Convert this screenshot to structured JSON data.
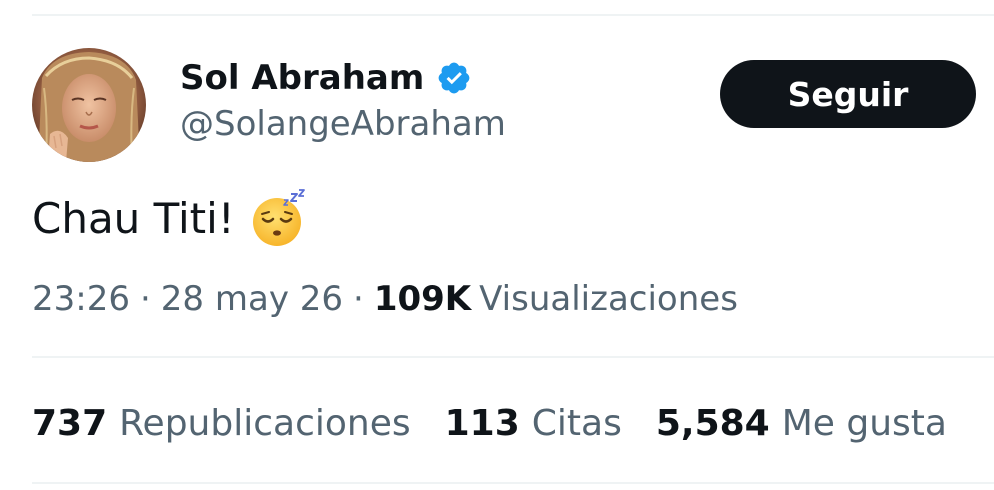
{
  "tweet": {
    "author": {
      "display_name": "Sol Abraham",
      "handle": "@SolangeAbraham",
      "verified_icon": "verified-badge-icon",
      "avatar_icon": "avatar-photo"
    },
    "follow_button": {
      "label": "Seguir"
    },
    "text": "Chau Titi!",
    "emoji_icon": "sleeping-face-emoji",
    "meta": {
      "time": "23:26",
      "separator": "·",
      "date": "28 may 26",
      "views_count": "109K",
      "views_label": "Visualizaciones"
    },
    "stats": [
      {
        "count": "737",
        "label": "Republicaciones"
      },
      {
        "count": "113",
        "label": "Citas"
      },
      {
        "count": "5,584",
        "label": "Me gusta"
      }
    ]
  },
  "colors": {
    "text_primary": "#0f1419",
    "text_secondary": "#536471",
    "verified_blue": "#1d9bf0",
    "button_bg": "#0f1419",
    "button_text": "#ffffff",
    "divider": "#eff3f4"
  }
}
